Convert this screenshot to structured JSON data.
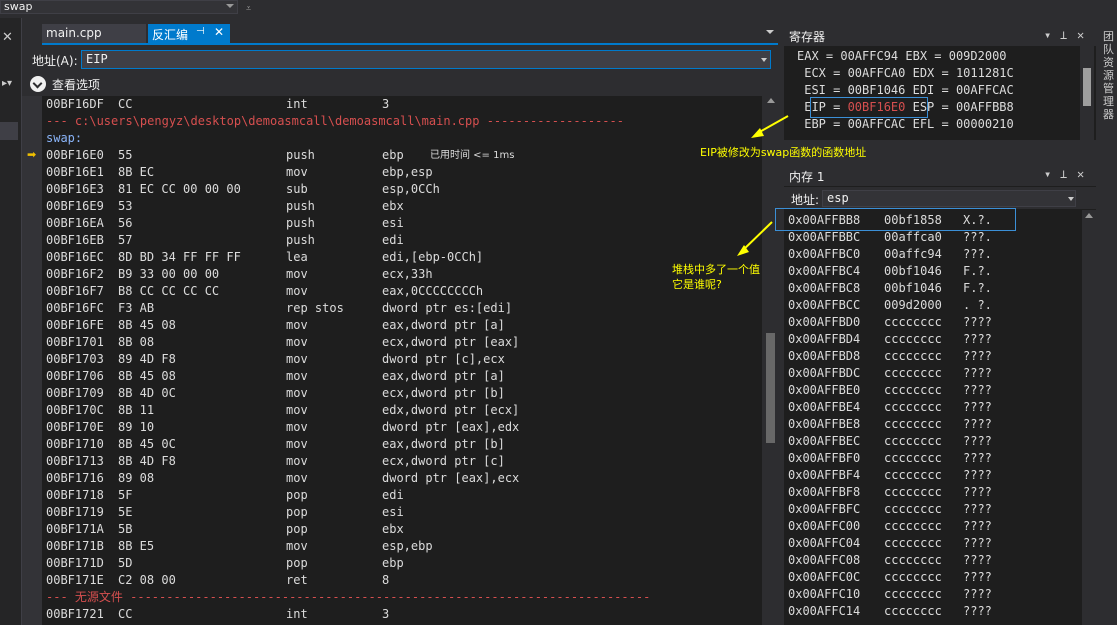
{
  "top": {
    "function_dropdown": "swap",
    "overflow_glyph": "⩡"
  },
  "tabs": [
    {
      "label": "main.cpp",
      "active": false
    },
    {
      "label": "反汇编",
      "active": true
    }
  ],
  "tab_pin_glyph": "⊣",
  "tab_close_glyph": "✕",
  "address_bar": {
    "label": "地址(A):",
    "value": "EIP"
  },
  "view_options": {
    "label": "查看选项"
  },
  "disassembly": {
    "source_line": "--- c:\\users\\pengyz\\desktop\\demoasmcall\\demoasmcall\\main.cpp -------------------",
    "function_label": "swap:",
    "no_source_line": "--- 无源文件 ------------------------------------------------------------------------",
    "elapsed_hint": "已用时间 <= 1ms",
    "instructions_before": [
      {
        "addr": "00BF16DF",
        "bytes": "CC",
        "mnemonic": "int",
        "operands": "3"
      }
    ],
    "instructions": [
      {
        "addr": "00BF16E0",
        "bytes": "55",
        "mnemonic": "push",
        "operands": "ebp"
      },
      {
        "addr": "00BF16E1",
        "bytes": "8B EC",
        "mnemonic": "mov",
        "operands": "ebp,esp"
      },
      {
        "addr": "00BF16E3",
        "bytes": "81 EC CC 00 00 00",
        "mnemonic": "sub",
        "operands": "esp,0CCh"
      },
      {
        "addr": "00BF16E9",
        "bytes": "53",
        "mnemonic": "push",
        "operands": "ebx"
      },
      {
        "addr": "00BF16EA",
        "bytes": "56",
        "mnemonic": "push",
        "operands": "esi"
      },
      {
        "addr": "00BF16EB",
        "bytes": "57",
        "mnemonic": "push",
        "operands": "edi"
      },
      {
        "addr": "00BF16EC",
        "bytes": "8D BD 34 FF FF FF",
        "mnemonic": "lea",
        "operands": "edi,[ebp-0CCh]"
      },
      {
        "addr": "00BF16F2",
        "bytes": "B9 33 00 00 00",
        "mnemonic": "mov",
        "operands": "ecx,33h"
      },
      {
        "addr": "00BF16F7",
        "bytes": "B8 CC CC CC CC",
        "mnemonic": "mov",
        "operands": "eax,0CCCCCCCCh"
      },
      {
        "addr": "00BF16FC",
        "bytes": "F3 AB",
        "mnemonic": "rep stos",
        "operands": "dword ptr es:[edi]"
      },
      {
        "addr": "00BF16FE",
        "bytes": "8B 45 08",
        "mnemonic": "mov",
        "operands": "eax,dword ptr [a]"
      },
      {
        "addr": "00BF1701",
        "bytes": "8B 08",
        "mnemonic": "mov",
        "operands": "ecx,dword ptr [eax]"
      },
      {
        "addr": "00BF1703",
        "bytes": "89 4D F8",
        "mnemonic": "mov",
        "operands": "dword ptr [c],ecx"
      },
      {
        "addr": "00BF1706",
        "bytes": "8B 45 08",
        "mnemonic": "mov",
        "operands": "eax,dword ptr [a]"
      },
      {
        "addr": "00BF1709",
        "bytes": "8B 4D 0C",
        "mnemonic": "mov",
        "operands": "ecx,dword ptr [b]"
      },
      {
        "addr": "00BF170C",
        "bytes": "8B 11",
        "mnemonic": "mov",
        "operands": "edx,dword ptr [ecx]"
      },
      {
        "addr": "00BF170E",
        "bytes": "89 10",
        "mnemonic": "mov",
        "operands": "dword ptr [eax],edx"
      },
      {
        "addr": "00BF1710",
        "bytes": "8B 45 0C",
        "mnemonic": "mov",
        "operands": "eax,dword ptr [b]"
      },
      {
        "addr": "00BF1713",
        "bytes": "8B 4D F8",
        "mnemonic": "mov",
        "operands": "ecx,dword ptr [c]"
      },
      {
        "addr": "00BF1716",
        "bytes": "89 08",
        "mnemonic": "mov",
        "operands": "dword ptr [eax],ecx"
      },
      {
        "addr": "00BF1718",
        "bytes": "5F",
        "mnemonic": "pop",
        "operands": "edi"
      },
      {
        "addr": "00BF1719",
        "bytes": "5E",
        "mnemonic": "pop",
        "operands": "esi"
      },
      {
        "addr": "00BF171A",
        "bytes": "5B",
        "mnemonic": "pop",
        "operands": "ebx"
      },
      {
        "addr": "00BF171B",
        "bytes": "8B E5",
        "mnemonic": "mov",
        "operands": "esp,ebp"
      },
      {
        "addr": "00BF171D",
        "bytes": "5D",
        "mnemonic": "pop",
        "operands": "ebp"
      },
      {
        "addr": "00BF171E",
        "bytes": "C2 08 00",
        "mnemonic": "ret",
        "operands": "8"
      }
    ],
    "instructions_after": [
      {
        "addr": "00BF1721",
        "bytes": "CC",
        "mnemonic": "int",
        "operands": "3"
      }
    ]
  },
  "registers": {
    "title": "寄存器",
    "lines": [
      "EAX = 00AFFC94 EBX = 009D2000",
      " ECX = 00AFFCA0 EDX = 1011281C",
      " ESI = 00BF1046 EDI = 00AFFCAC"
    ],
    "eip_label": " EIP = ",
    "eip_value": "00BF16E0",
    "eip_rest": " ESP = 00AFFBB8",
    "last_line": " EBP = 00AFFCAC EFL = 00000210"
  },
  "memory": {
    "title": "内存 1",
    "address_label": "地址:",
    "address_value": "esp",
    "rows": [
      {
        "addr": "0x00AFFBB8",
        "value": "00bf1858",
        "ascii": "X.?."
      },
      {
        "addr": "0x00AFFBBC",
        "value": "00affca0",
        "ascii": "???."
      },
      {
        "addr": "0x00AFFBC0",
        "value": "00affc94",
        "ascii": "???."
      },
      {
        "addr": "0x00AFFBC4",
        "value": "00bf1046",
        "ascii": "F.?."
      },
      {
        "addr": "0x00AFFBC8",
        "value": "00bf1046",
        "ascii": "F.?."
      },
      {
        "addr": "0x00AFFBCC",
        "value": "009d2000",
        "ascii": ". ?."
      },
      {
        "addr": "0x00AFFBD0",
        "value": "cccccccc",
        "ascii": "????"
      },
      {
        "addr": "0x00AFFBD4",
        "value": "cccccccc",
        "ascii": "????"
      },
      {
        "addr": "0x00AFFBD8",
        "value": "cccccccc",
        "ascii": "????"
      },
      {
        "addr": "0x00AFFBDC",
        "value": "cccccccc",
        "ascii": "????"
      },
      {
        "addr": "0x00AFFBE0",
        "value": "cccccccc",
        "ascii": "????"
      },
      {
        "addr": "0x00AFFBE4",
        "value": "cccccccc",
        "ascii": "????"
      },
      {
        "addr": "0x00AFFBE8",
        "value": "cccccccc",
        "ascii": "????"
      },
      {
        "addr": "0x00AFFBEC",
        "value": "cccccccc",
        "ascii": "????"
      },
      {
        "addr": "0x00AFFBF0",
        "value": "cccccccc",
        "ascii": "????"
      },
      {
        "addr": "0x00AFFBF4",
        "value": "cccccccc",
        "ascii": "????"
      },
      {
        "addr": "0x00AFFBF8",
        "value": "cccccccc",
        "ascii": "????"
      },
      {
        "addr": "0x00AFFBFC",
        "value": "cccccccc",
        "ascii": "????"
      },
      {
        "addr": "0x00AFFC00",
        "value": "cccccccc",
        "ascii": "????"
      },
      {
        "addr": "0x00AFFC04",
        "value": "cccccccc",
        "ascii": "????"
      },
      {
        "addr": "0x00AFFC08",
        "value": "cccccccc",
        "ascii": "????"
      },
      {
        "addr": "0x00AFFC0C",
        "value": "cccccccc",
        "ascii": "????"
      },
      {
        "addr": "0x00AFFC10",
        "value": "cccccccc",
        "ascii": "????"
      },
      {
        "addr": "0x00AFFC14",
        "value": "cccccccc",
        "ascii": "????"
      }
    ]
  },
  "right_strip": {
    "text": "团队资源管理器"
  },
  "annotations": {
    "eip_note": "EIP被修改为swap函数的函数地址",
    "stack_note_line1": "堆栈中多了一个值",
    "stack_note_line2": "它是谁呢?"
  },
  "colors": {
    "accent": "#007acc",
    "source_red": "#d64f4f",
    "annotation_yellow": "#ffff00",
    "highlight_box": "#3b8fd6"
  }
}
